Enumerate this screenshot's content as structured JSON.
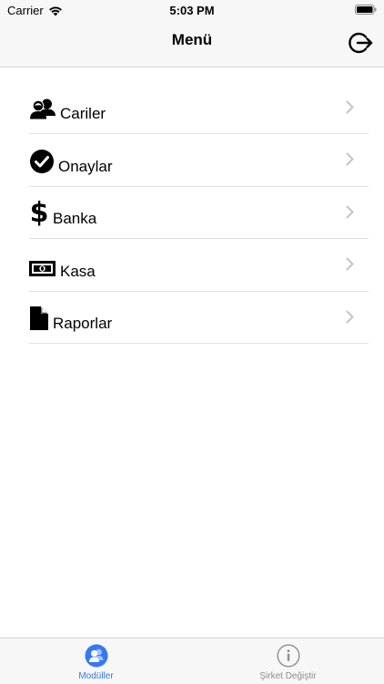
{
  "status_bar": {
    "carrier": "Carrier",
    "time": "5:03 PM"
  },
  "nav": {
    "title": "Menü",
    "logout_icon": "logout-icon"
  },
  "menu": {
    "items": [
      {
        "label": "Cariler",
        "icon": "users-icon"
      },
      {
        "label": "Onaylar",
        "icon": "check-circle-icon"
      },
      {
        "label": "Banka",
        "icon": "dollar-icon"
      },
      {
        "label": "Kasa",
        "icon": "money-icon"
      },
      {
        "label": "Raporlar",
        "icon": "document-icon"
      }
    ]
  },
  "tabs": [
    {
      "label": "Modüller",
      "icon": "modules-icon",
      "active": true
    },
    {
      "label": "Şirket Değiştir",
      "icon": "info-icon",
      "active": false
    }
  ],
  "colors": {
    "accent": "#3478f6",
    "inactive": "#8e8e93"
  }
}
